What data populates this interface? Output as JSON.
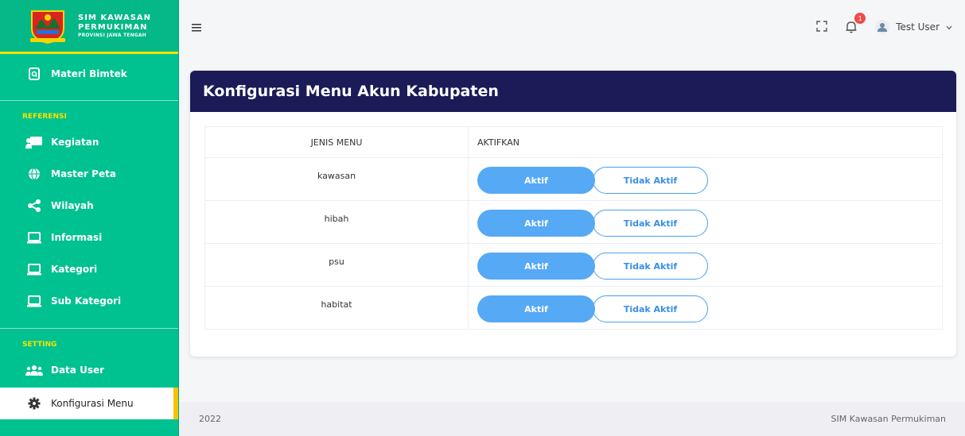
{
  "brand": {
    "line1": "SIM KAWASAN",
    "line2": "PERMUKIMAN",
    "line3": "PROVINSI JAWA TENGAH"
  },
  "sidebar": {
    "top_item": {
      "label": "Materi Bimtek",
      "icon": "document-search-icon"
    },
    "section_referensi": "REFERENSI",
    "referensi_items": [
      {
        "label": "Kegiatan",
        "icon": "presentation-icon"
      },
      {
        "label": "Master Peta",
        "icon": "globe-icon"
      },
      {
        "label": "Wilayah",
        "icon": "share-icon"
      },
      {
        "label": "Informasi",
        "icon": "laptop-icon"
      },
      {
        "label": "Kategori",
        "icon": "laptop-icon"
      },
      {
        "label": "Sub Kategori",
        "icon": "laptop-icon"
      }
    ],
    "section_setting": "SETTING",
    "setting_items": [
      {
        "label": "Data User",
        "icon": "users-icon"
      },
      {
        "label": "Konfigurasi Menu",
        "icon": "gear-icon"
      }
    ]
  },
  "topbar": {
    "notification_count": "1",
    "user_name": "Test User"
  },
  "card": {
    "title": "Konfigurasi Menu Akun Kabupaten",
    "columns": [
      "JENIS MENU",
      "AKTIFKAN"
    ],
    "rows": [
      {
        "menu": "kawasan",
        "btn_on": "Aktif",
        "btn_off": "Tidak Aktif"
      },
      {
        "menu": "hibah",
        "btn_on": "Aktif",
        "btn_off": "Tidak Aktif"
      },
      {
        "menu": "psu",
        "btn_on": "Aktif",
        "btn_off": "Tidak Aktif"
      },
      {
        "menu": "habitat",
        "btn_on": "Aktif",
        "btn_off": "Tidak Aktif"
      }
    ]
  },
  "footer": {
    "year": "2022",
    "app_name": "SIM Kawasan Permukiman"
  },
  "colors": {
    "sidebar": "#00c190",
    "header": "#1a1b57",
    "accent": "#56a9f4",
    "section": "#f5e200"
  }
}
